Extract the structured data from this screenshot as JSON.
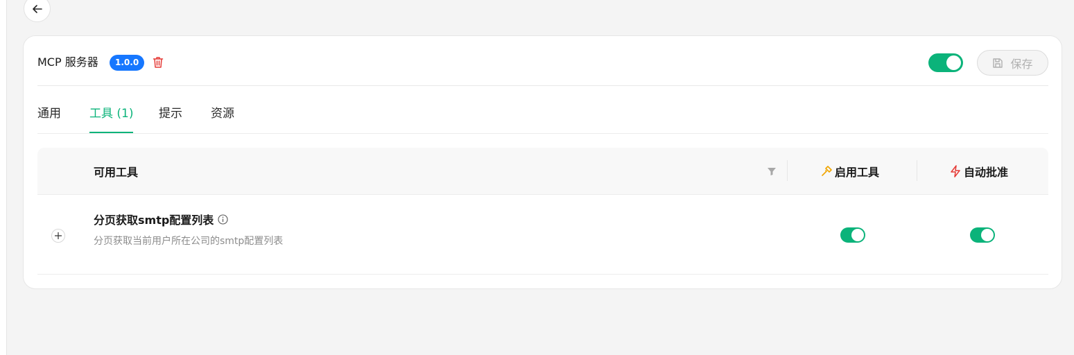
{
  "header": {
    "title": "MCP 服务器",
    "version": "1.0.0",
    "enabled": true,
    "save_label": "保存"
  },
  "tabs": [
    {
      "label": "通用",
      "active": false
    },
    {
      "label": "工具 (1)",
      "active": true
    },
    {
      "label": "提示",
      "active": false
    },
    {
      "label": "资源",
      "active": false
    }
  ],
  "table": {
    "columns": {
      "tools": "可用工具",
      "enable": "启用工具",
      "auto_approve": "自动批准"
    },
    "rows": [
      {
        "name": "分页获取smtp配置列表",
        "description": "分页获取当前用户所在公司的smtp配置列表",
        "enabled": true,
        "auto_approve": true
      }
    ]
  },
  "colors": {
    "accent": "#0bb37a",
    "badge": "#1677ff",
    "danger": "#e53935",
    "enable_icon": "#f0a500"
  },
  "icons": [
    "back-arrow-icon",
    "trash-icon",
    "save-icon",
    "filter-icon",
    "hammer-icon",
    "lightning-icon",
    "plus-icon",
    "info-icon"
  ]
}
